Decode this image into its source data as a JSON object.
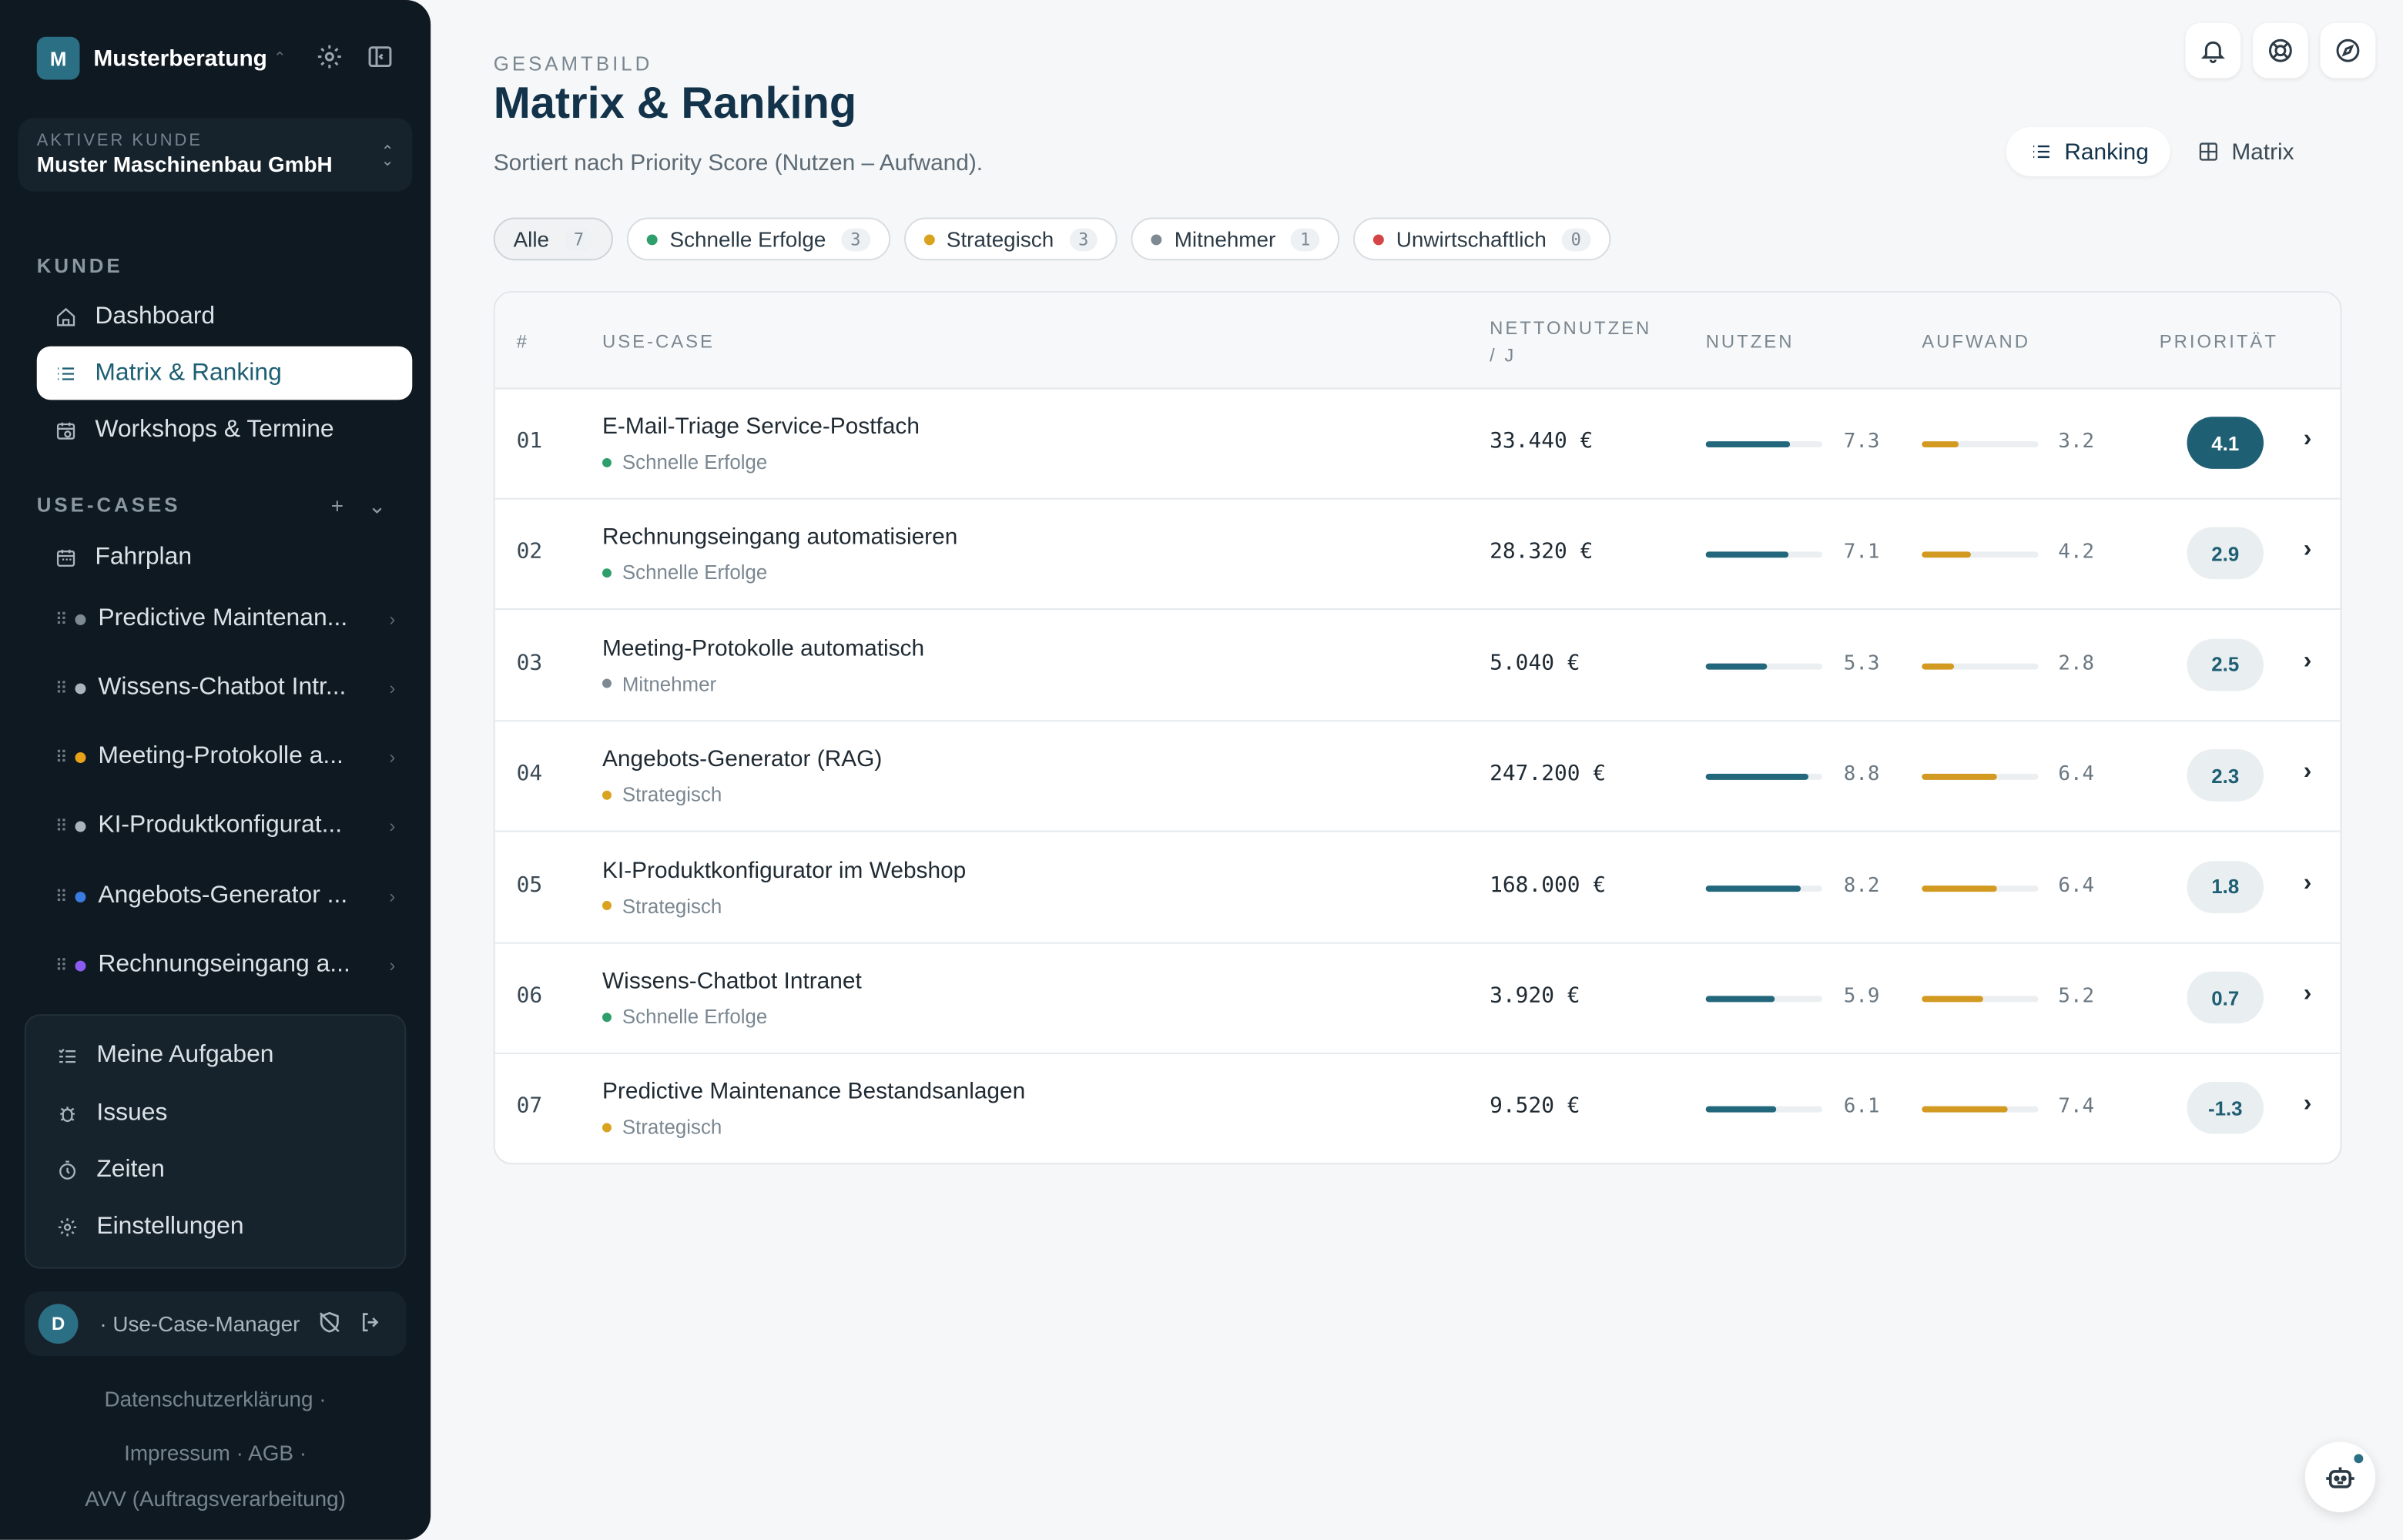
{
  "sidebar": {
    "brand": {
      "logo_letter": "M",
      "name": "Musterberatung"
    },
    "client": {
      "label": "AKTIVER KUNDE",
      "name": "Muster Maschinenbau GmbH"
    },
    "section_kunde": "KUNDE",
    "nav": [
      {
        "label": "Dashboard",
        "icon": "home-icon"
      },
      {
        "label": "Matrix & Ranking",
        "icon": "list-icon",
        "active": true
      },
      {
        "label": "Workshops & Termine",
        "icon": "calendar-clock-icon"
      }
    ],
    "section_usecases": "USE-CASES",
    "fahrplan": "Fahrplan",
    "usecases": [
      {
        "label": "Predictive Maintenan...",
        "color": "#7d8a94"
      },
      {
        "label": "Wissens-Chatbot Intr...",
        "color": "#aab4bb"
      },
      {
        "label": "Meeting-Protokolle a...",
        "color": "#e8a21a"
      },
      {
        "label": "KI-Produktkonfigurat...",
        "color": "#aab4bb"
      },
      {
        "label": "Angebots-Generator ...",
        "color": "#3a7be0"
      },
      {
        "label": "Rechnungseingang a...",
        "color": "#8a5cf0"
      }
    ],
    "bottom": [
      {
        "label": "Meine Aufgaben",
        "icon": "tasks-icon"
      },
      {
        "label": "Issues",
        "icon": "bug-icon"
      },
      {
        "label": "Zeiten",
        "icon": "timer-icon"
      },
      {
        "label": "Einstellungen",
        "icon": "gear-icon"
      }
    ],
    "user": {
      "initial": "D",
      "role": "· Use-Case-Manager"
    },
    "footer": {
      "datenschutz": "Datenschutzerklärung",
      "impressum": "Impressum",
      "agb": "AGB",
      "avv": "AVV (Auftragsverarbeitung)"
    }
  },
  "main": {
    "kicker": "GESAMTBILD",
    "title": "Matrix & Ranking",
    "subtitle": "Sortiert nach Priority Score (Nutzen – Aufwand).",
    "view_tabs": {
      "ranking": "Ranking",
      "matrix": "Matrix"
    },
    "filters": [
      {
        "label": "Alle",
        "count": "7"
      },
      {
        "label": "Schnelle Erfolge",
        "count": "3",
        "color": "#2e9e6a"
      },
      {
        "label": "Strategisch",
        "count": "3",
        "color": "#d9a21f"
      },
      {
        "label": "Mitnehmer",
        "count": "1",
        "color": "#7d8a94"
      },
      {
        "label": "Unwirtschaftlich",
        "count": "0",
        "color": "#d64545"
      }
    ],
    "table": {
      "headers": {
        "num": "#",
        "usecase": "USE-CASE",
        "netto": "NETTONUTZEN / J",
        "nutzen": "NUTZEN",
        "aufwand": "AUFWAND",
        "prio": "PRIORITÄT"
      },
      "rows": [
        {
          "num": "01",
          "name": "E-Mail-Triage Service-Postfach",
          "category": "Schnelle Erfolge",
          "cat_color": "#2e9e6a",
          "netto": "33.440 €",
          "nutzen": "7.3",
          "aufwand": "3.2",
          "prio": "4.1",
          "nutzen_frac": 0.73,
          "aufwand_frac": 0.32,
          "prio_top": true
        },
        {
          "num": "02",
          "name": "Rechnungseingang automatisieren",
          "category": "Schnelle Erfolge",
          "cat_color": "#2e9e6a",
          "netto": "28.320 €",
          "nutzen": "7.1",
          "aufwand": "4.2",
          "prio": "2.9",
          "nutzen_frac": 0.71,
          "aufwand_frac": 0.42
        },
        {
          "num": "03",
          "name": "Meeting-Protokolle automatisch",
          "category": "Mitnehmer",
          "cat_color": "#7d8a94",
          "netto": "5.040 €",
          "nutzen": "5.3",
          "aufwand": "2.8",
          "prio": "2.5",
          "nutzen_frac": 0.53,
          "aufwand_frac": 0.28
        },
        {
          "num": "04",
          "name": "Angebots-Generator (RAG)",
          "category": "Strategisch",
          "cat_color": "#d9a21f",
          "netto": "247.200 €",
          "nutzen": "8.8",
          "aufwand": "6.4",
          "prio": "2.3",
          "nutzen_frac": 0.88,
          "aufwand_frac": 0.64
        },
        {
          "num": "05",
          "name": "KI-Produktkonfigurator im Webshop",
          "category": "Strategisch",
          "cat_color": "#d9a21f",
          "netto": "168.000 €",
          "nutzen": "8.2",
          "aufwand": "6.4",
          "prio": "1.8",
          "nutzen_frac": 0.82,
          "aufwand_frac": 0.64
        },
        {
          "num": "06",
          "name": "Wissens-Chatbot Intranet",
          "category": "Schnelle Erfolge",
          "cat_color": "#2e9e6a",
          "netto": "3.920 €",
          "nutzen": "5.9",
          "aufwand": "5.2",
          "prio": "0.7",
          "nutzen_frac": 0.59,
          "aufwand_frac": 0.52
        },
        {
          "num": "07",
          "name": "Predictive Maintenance Bestandsanlagen",
          "category": "Strategisch",
          "cat_color": "#d9a21f",
          "netto": "9.520 €",
          "nutzen": "6.1",
          "aufwand": "7.4",
          "prio": "-1.3",
          "nutzen_frac": 0.61,
          "aufwand_frac": 0.74
        }
      ]
    }
  },
  "colors": {
    "accent": "#2b6f84",
    "nutzen_bar": "#23677c",
    "aufwand_bar": "#d39a22",
    "prio_top_bg": "#1e5f73",
    "prio_bg": "#e9eef1",
    "prio_text": "#1e5f73"
  }
}
